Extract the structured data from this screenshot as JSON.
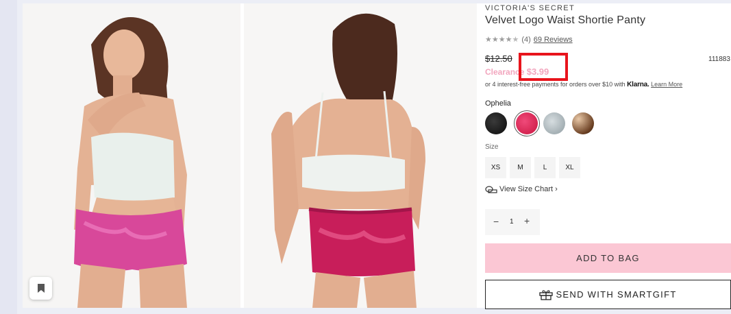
{
  "product": {
    "brand": "VICTORIA'S SECRET",
    "title": "Velvet Logo Waist Shortie Panty",
    "rating": 4,
    "rating_max": 5,
    "rating_count": "(4)",
    "reviews_link": "69 Reviews",
    "original_price": "$12.50",
    "sku": "111883",
    "sale_label": "Clearance",
    "sale_price": "$3.99",
    "klarna_text": "or 4 interest-free payments for orders over $10 with",
    "klarna_brand": "Klarna.",
    "learn_more": "Learn More",
    "color_name": "Ophelia",
    "swatches": [
      {
        "name": "black",
        "color": "#141414"
      },
      {
        "name": "pink",
        "color": "#d81f55"
      },
      {
        "name": "silver",
        "color": "#a9b4b8"
      },
      {
        "name": "leopard",
        "color": "#b88b68"
      }
    ],
    "size_label": "Size",
    "sizes": [
      "XS",
      "M",
      "L",
      "XL"
    ],
    "size_chart": "View Size Chart",
    "quantity": "1",
    "add_to_bag": "ADD TO BAG",
    "smartgift": "SEND WITH SMARTGIFT"
  },
  "colors": {
    "sale_pink": "#f2a6be",
    "add_to_bag_bg": "#fbc7d4",
    "highlight_red": "#e8141c"
  }
}
